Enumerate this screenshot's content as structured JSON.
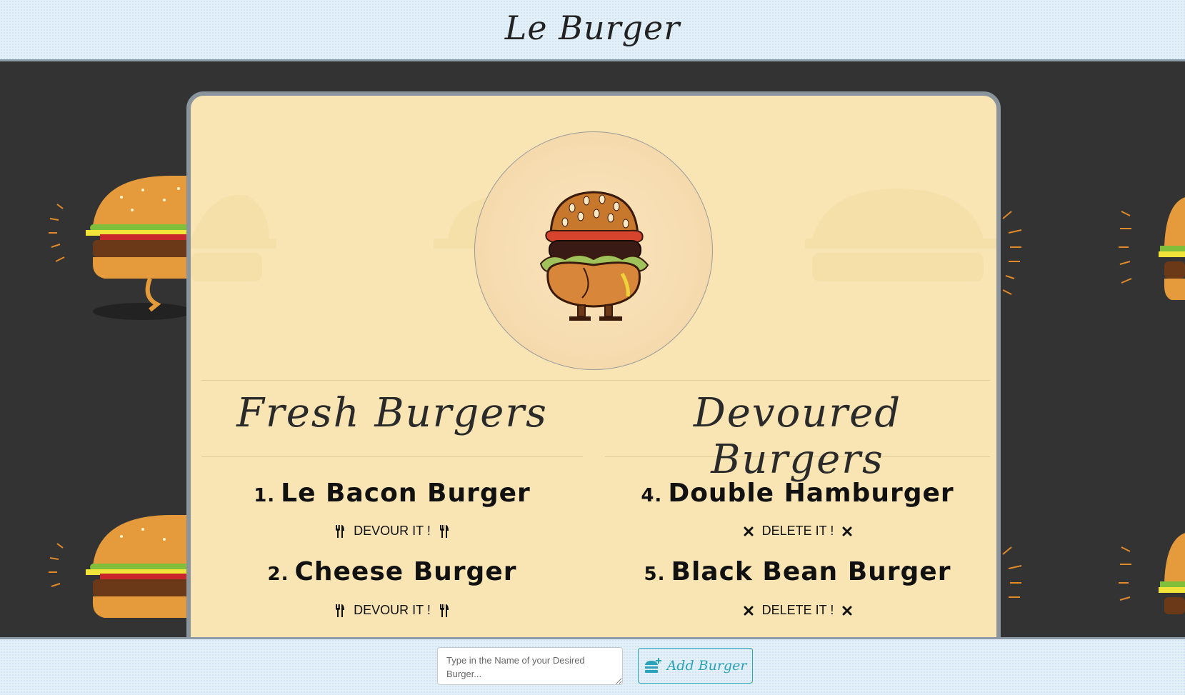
{
  "header": {
    "title": "Le Burger"
  },
  "fresh": {
    "title": "Fresh Burgers",
    "items": [
      {
        "number": "1.",
        "name": "Le Bacon Burger",
        "action": "DEVOUR IT !"
      },
      {
        "number": "2.",
        "name": "Cheese Burger",
        "action": "DEVOUR IT !"
      }
    ]
  },
  "devoured": {
    "title": "Devoured Burgers",
    "items": [
      {
        "number": "4.",
        "name": "Double Hamburger",
        "action": "DELETE IT !"
      },
      {
        "number": "5.",
        "name": "Black Bean Burger",
        "action": "DELETE IT !"
      }
    ]
  },
  "footer": {
    "input_placeholder": "Type in the Name of your Desired Burger...",
    "add_label": "Add Burger"
  },
  "colors": {
    "card_bg": "#f9e5b4",
    "page_bg": "#333333",
    "bar_bg": "#e4f0f8",
    "accent": "#2aa3b8"
  },
  "icons": {
    "devour": "fork-knife-icon",
    "delete": "close-icon",
    "add": "burger-add-icon"
  }
}
